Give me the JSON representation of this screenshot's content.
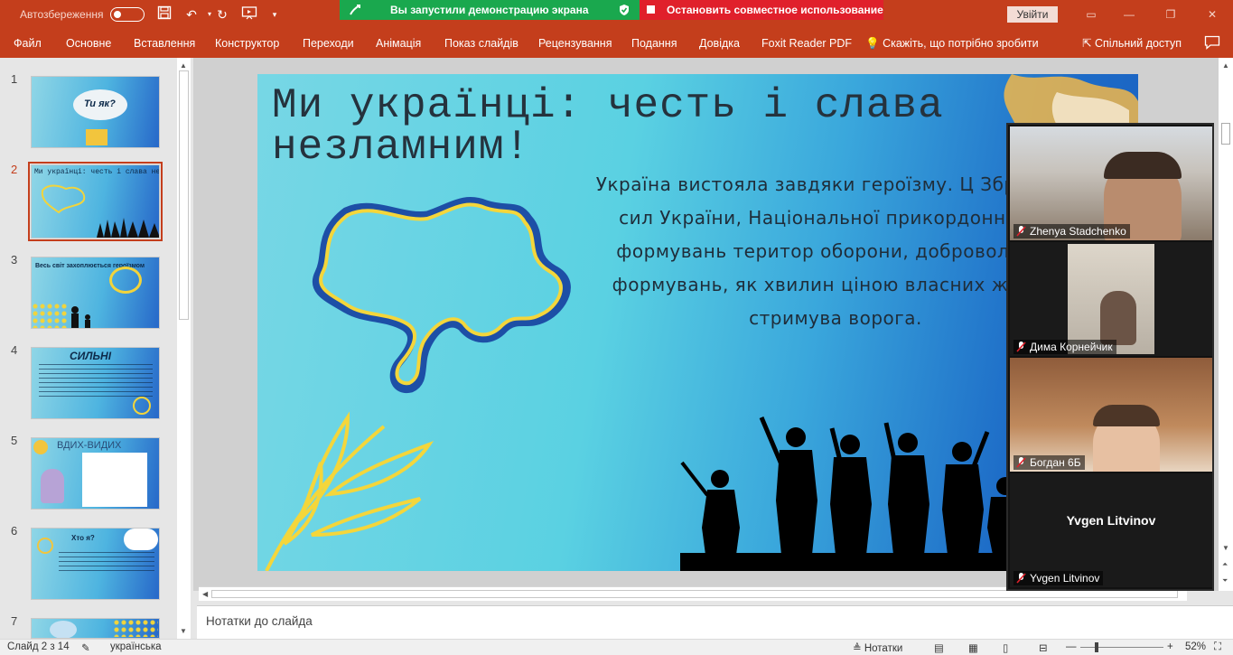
{
  "titlebar": {
    "autosave_label": "Автозбереження",
    "share_status": "Вы запустили демонстрацию экрана",
    "stop_share": "Остановить совместное использование",
    "signin_label": "Увійти"
  },
  "ribbon": {
    "tabs": [
      "Файл",
      "Основне",
      "Вставлення",
      "Конструктор",
      "Переходи",
      "Анімація",
      "Показ слайдів",
      "Рецензування",
      "Подання",
      "Довідка",
      "Foxit Reader PDF"
    ],
    "tell_me": "Скажіть, що потрібно зробити",
    "share_label": "Спільний доступ"
  },
  "thumbnails": [
    {
      "number": "1",
      "caption": "Ти як?"
    },
    {
      "number": "2",
      "caption": "Ми українці: честь і слава незламним!"
    },
    {
      "number": "3",
      "caption": "Весь світ захоплюється героїзмом"
    },
    {
      "number": "4",
      "caption": "СИЛЬНІ"
    },
    {
      "number": "5",
      "caption": "ВДИХ-ВИДИХ"
    },
    {
      "number": "6",
      "caption": "Хто я?"
    },
    {
      "number": "7",
      "caption": ""
    }
  ],
  "slide": {
    "title": "Ми українці: честь і слава незламним!",
    "body": "Україна вистояла завдяки героїзму. Ц Збройних сил України, Національної прикордонників, формувань територ оборони, добровольчих формувань, як хвилин ціною власних життів стримува ворога."
  },
  "zoom": {
    "participants": [
      {
        "name": "Zhenya Stadchenko",
        "muted": true
      },
      {
        "name": "Дима Корнейчик",
        "muted": true
      },
      {
        "name": "Богдан 6Б",
        "muted": true
      },
      {
        "name": "Yvgen Litvinov",
        "muted": true,
        "display": "Yvgen Litvinov"
      }
    ]
  },
  "notes": {
    "placeholder": "Нотатки до слайда"
  },
  "status": {
    "slide_info": "Слайд 2 з 14",
    "language": "українська",
    "notes_btn": "Нотатки",
    "zoom_level": "52%"
  },
  "colors": {
    "accent": "#c43e1c",
    "share_green": "#1aa84e",
    "share_red": "#e0202b"
  }
}
